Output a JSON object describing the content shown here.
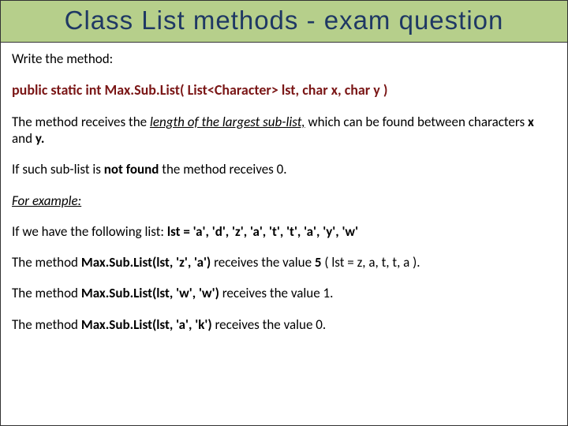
{
  "title": "Class  List  methods -  exam  question",
  "p1": "Write the method:",
  "signature": "public  static  int  Max.Sub.List( List<Character>  lst,  char  x, char  y )",
  "p2a": "The method receives the ",
  "p2b": "length of the largest  sub-list,",
  "p2c": " which can be found between characters ",
  "p2d": "x",
  "p2e": " and ",
  "p2f": "y.",
  "p3a": " If such sub-list is ",
  "p3b": "not found",
  "p3c": " the method receives  0.",
  "p4": "For example:",
  "p5a": "If  we  have  the  following  list:   ",
  "p5b": "lst = 'a', 'd', 'z', 'a', 't', 't', 'a', 'y', 'w'",
  "p6a": "The method  ",
  "p6b": "Max.Sub.List(lst, 'z', 'a')",
  "p6c": "  receives  the  value  ",
  "p6d": "5",
  "p6e": " ( lst  =  z, a, t, t, a ).",
  "p7a": "The method  ",
  "p7b": "Max.Sub.List(lst, 'w', 'w')",
  "p7c": "  receives  the  value  1.",
  "p8a": "The method  ",
  "p8b": "Max.Sub.List(lst, 'a', 'k')",
  "p8c": "  receives the  value  0."
}
